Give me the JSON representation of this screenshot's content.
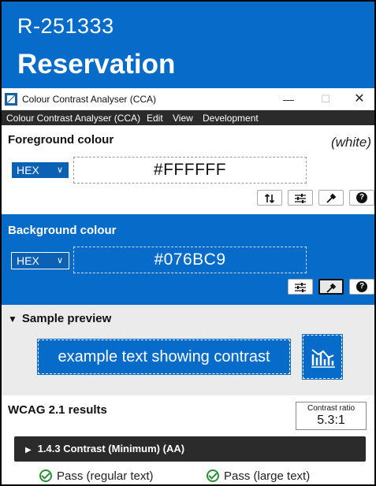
{
  "header": {
    "reference": "R-251333",
    "title": "Reservation"
  },
  "window": {
    "title": "Colour Contrast Analyser (CCA)",
    "controls": {
      "minimize": "—",
      "maximize": "☐",
      "close": "✕"
    }
  },
  "menu": {
    "items": [
      "Colour Contrast Analyser (CCA)",
      "Edit",
      "View",
      "Development"
    ]
  },
  "foreground": {
    "heading": "Foreground colour",
    "colour_name": "(white)",
    "format": "HEX",
    "value": "#FFFFFF",
    "tools": [
      "swap-icon",
      "sliders-icon",
      "eyedropper-icon",
      "help-icon"
    ]
  },
  "background": {
    "heading": "Background colour",
    "format": "HEX",
    "value": "#076BC9",
    "tools": [
      "sliders-icon",
      "eyedropper-icon",
      "help-icon"
    ]
  },
  "preview": {
    "heading": "Sample preview",
    "sample_text": "example text showing contrast"
  },
  "results": {
    "heading": "WCAG 2.1 results",
    "ratio_label": "Contrast ratio",
    "ratio_value": "5.3:1",
    "criterion": "1.4.3 Contrast (Minimum) (AA)",
    "pass_regular": "Pass (regular text)",
    "pass_large": "Pass (large text)"
  },
  "colors": {
    "brand_blue": "#076BC9",
    "menubar": "#2b2b2b",
    "pass_green": "#2d8f35"
  }
}
